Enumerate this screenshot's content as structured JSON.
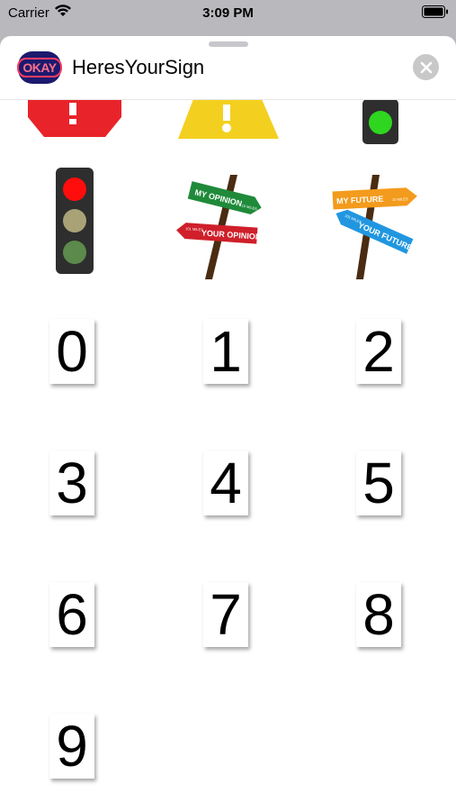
{
  "status_bar": {
    "carrier": "Carrier",
    "time": "3:09 PM"
  },
  "header": {
    "app_title": "HeresYourSign",
    "logo_text": "OKAY",
    "close_icon": "close-icon"
  },
  "signs": {
    "stop_sign": {
      "name": "stop-sign"
    },
    "warning_sign": {
      "name": "warning-sign"
    },
    "traffic_light_green": {
      "name": "traffic-light-green"
    },
    "traffic_light_red": {
      "name": "traffic-light-red"
    },
    "opinion_signpost": {
      "top": "MY OPINION",
      "top_small": "10 MILES",
      "bottom": "YOUR OPINION",
      "bottom_small": "101 MILES"
    },
    "future_signpost": {
      "top": "MY FUTURE",
      "top_small": "10 MILES",
      "bottom": "YOUR FUTURE",
      "bottom_small": "101 MILES"
    }
  },
  "numbers": [
    "0",
    "1",
    "2",
    "3",
    "4",
    "5",
    "6",
    "7",
    "8",
    "9"
  ]
}
